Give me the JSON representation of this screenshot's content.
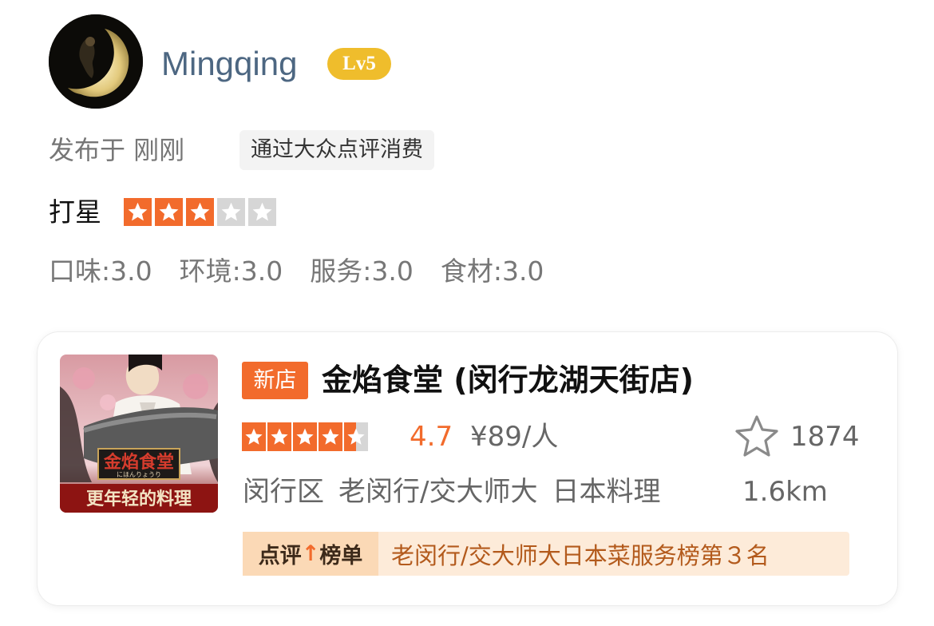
{
  "user": {
    "name": "Mingqing",
    "level": "Lv5"
  },
  "post": {
    "time_label": "发布于 刚刚",
    "via_tag": "通过大众点评消费"
  },
  "rating": {
    "label": "打星",
    "stars": 3,
    "max_stars": 5,
    "accent_color": "#f26b2c",
    "sub_scores": [
      {
        "text": "口味:3.0"
      },
      {
        "text": "环境:3.0"
      },
      {
        "text": "服务:3.0"
      },
      {
        "text": "食材:3.0"
      }
    ]
  },
  "shop": {
    "new_tag": "新店",
    "name": "金焰食堂 (闵行龙湖天街店)",
    "star_rating": 4.5,
    "score": "4.7",
    "price": "¥89/人",
    "favorites": "1874",
    "district": "闵行区",
    "area": "老闵行/交大师大",
    "cuisine": "日本料理",
    "distance": "1.6km",
    "ranking": {
      "label_pre": "点评",
      "label_arrow": "↑",
      "label_post": "榜单",
      "text": "老闵行/交大师大日本菜服务榜第３名"
    },
    "image": {
      "sign_text": "金焰食堂",
      "sub_text": "にほんりょうり",
      "tagline": "更年轻的料理"
    }
  }
}
